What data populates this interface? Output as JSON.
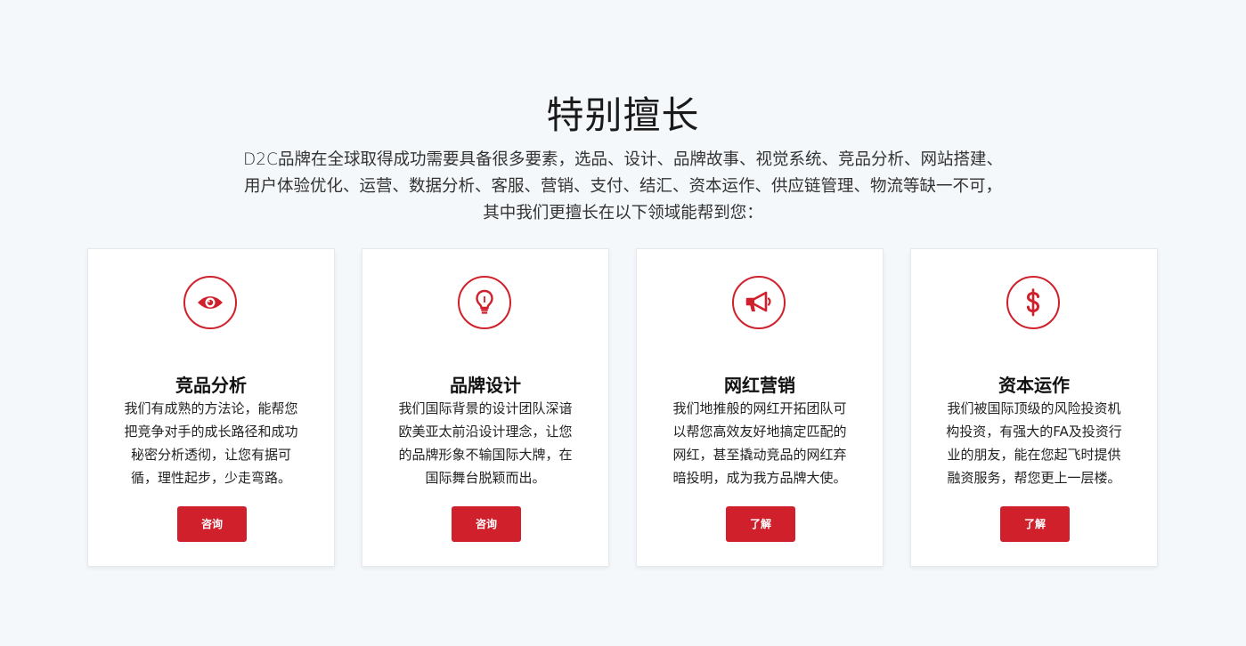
{
  "section": {
    "title": "特别擅长",
    "intro_lines": [
      "D2C品牌在全球取得成功需要具备很多要素，选品、设计、品牌故事、视觉系统、竞品分析、网站搭建、",
      "用户体验优化、运营、数据分析、客服、营销、支付、结汇、资本运作、供应链管理、物流等缺一不可，",
      "其中我们更擅长在以下领域能帮到您："
    ]
  },
  "colors": {
    "accent": "#d0202c",
    "background": "#f4f8fb",
    "card": "#ffffff"
  },
  "cards": [
    {
      "icon": "eye-icon",
      "title": "竞品分析",
      "desc_lines": [
        "我们有成熟的方法论，能帮您",
        "把竞争对手的成长路径和成功",
        "秘密分析透彻，让您有据可",
        "循，理性起步，少走弯路。"
      ],
      "button": "咨询"
    },
    {
      "icon": "lightbulb-icon",
      "title": "品牌设计",
      "desc_lines": [
        "我们国际背景的设计团队深谙",
        "欧美亚太前沿设计理念，让您",
        "的品牌形象不输国际大牌，在",
        "国际舞台脱颖而出。"
      ],
      "button": "咨询"
    },
    {
      "icon": "megaphone-icon",
      "title": "网红营销",
      "desc_lines": [
        "我们地推般的网红开拓团队可",
        "以帮您高效友好地搞定匹配的",
        "网红，甚至撬动竞品的网红弃",
        "暗投明，成为我方品牌大使。"
      ],
      "button": "了解"
    },
    {
      "icon": "dollar-icon",
      "title": "资本运作",
      "desc_lines": [
        "我们被国际顶级的风险投资机",
        "构投资，有强大的FA及投资行",
        "业的朋友，能在您起飞时提供",
        "融资服务，帮您更上一层楼。"
      ],
      "button": "了解"
    }
  ]
}
